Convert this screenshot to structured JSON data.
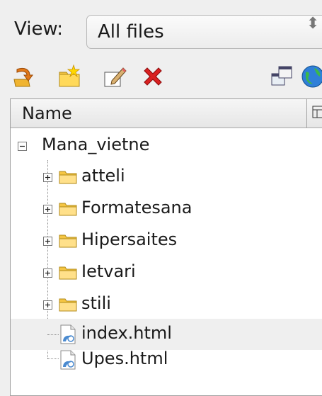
{
  "view": {
    "label": "View:",
    "selected": "All files"
  },
  "toolbar": {
    "buttons": [
      {
        "name": "import-site",
        "icon": "arrow-into-folder-icon"
      },
      {
        "name": "new-folder",
        "icon": "new-folder-icon"
      },
      {
        "name": "rename",
        "icon": "edit-pencil-icon"
      },
      {
        "name": "delete",
        "icon": "red-x-icon"
      },
      {
        "name": "sync",
        "icon": "two-windows-icon"
      },
      {
        "name": "publish",
        "icon": "globe-icon"
      }
    ]
  },
  "tree": {
    "header": {
      "name": "Name"
    },
    "root": {
      "label": "Mana_vietne",
      "expander": "⊟"
    },
    "items": [
      {
        "label": "atteli",
        "type": "folder"
      },
      {
        "label": "Formatesana",
        "type": "folder"
      },
      {
        "label": "Hipersaites",
        "type": "folder"
      },
      {
        "label": "Ietvari",
        "type": "folder"
      },
      {
        "label": "stili",
        "type": "folder"
      },
      {
        "label": "index.html",
        "type": "file",
        "highlighted": true
      },
      {
        "label": "Upes.html",
        "type": "file"
      }
    ]
  },
  "colors": {
    "folder": "#f5c542",
    "delete": "#d92020",
    "globe": "#2f7fd8",
    "highlight": "#efefef"
  }
}
